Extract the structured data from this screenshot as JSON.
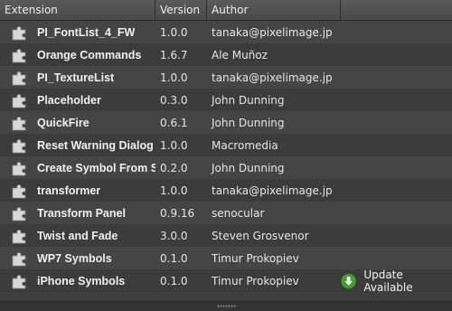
{
  "columns": {
    "extension": "Extension",
    "version": "Version",
    "author": "Author"
  },
  "rows": [
    {
      "name": "PI_FontList_4_FW",
      "version": "1.0.0",
      "author": "tanaka@pixelimage.jp"
    },
    {
      "name": "Orange Commands",
      "version": "1.6.7",
      "author": "Ale Muñoz"
    },
    {
      "name": "PI_TextureList",
      "version": "1.0.0",
      "author": "tanaka@pixelimage.jp"
    },
    {
      "name": "Placeholder",
      "version": "0.3.0",
      "author": "John Dunning"
    },
    {
      "name": "QuickFire",
      "version": "0.6.1",
      "author": "John Dunning"
    },
    {
      "name": "Reset Warning Dialog",
      "version": "1.0.0",
      "author": "Macromedia"
    },
    {
      "name": "Create Symbol From S",
      "version": "0.2.0",
      "author": "John Dunning"
    },
    {
      "name": "transformer",
      "version": "1.0.0",
      "author": "tanaka@pixelimage.jp"
    },
    {
      "name": "Transform Panel",
      "version": "0.9.16",
      "author": "senocular"
    },
    {
      "name": "Twist and Fade",
      "version": "3.0.0",
      "author": "Steven Grosvenor"
    },
    {
      "name": "WP7 Symbols",
      "version": "0.1.0",
      "author": "Timur Prokopiev"
    },
    {
      "name": "iPhone Symbols",
      "version": "0.1.0",
      "author": "Timur Prokopiev",
      "status": "Update Available"
    }
  ],
  "icons": {
    "row_icon": "puzzle-piece-icon",
    "update_icon": "download-arrow-icon"
  },
  "colors": {
    "update_green": "#3fa52a"
  }
}
